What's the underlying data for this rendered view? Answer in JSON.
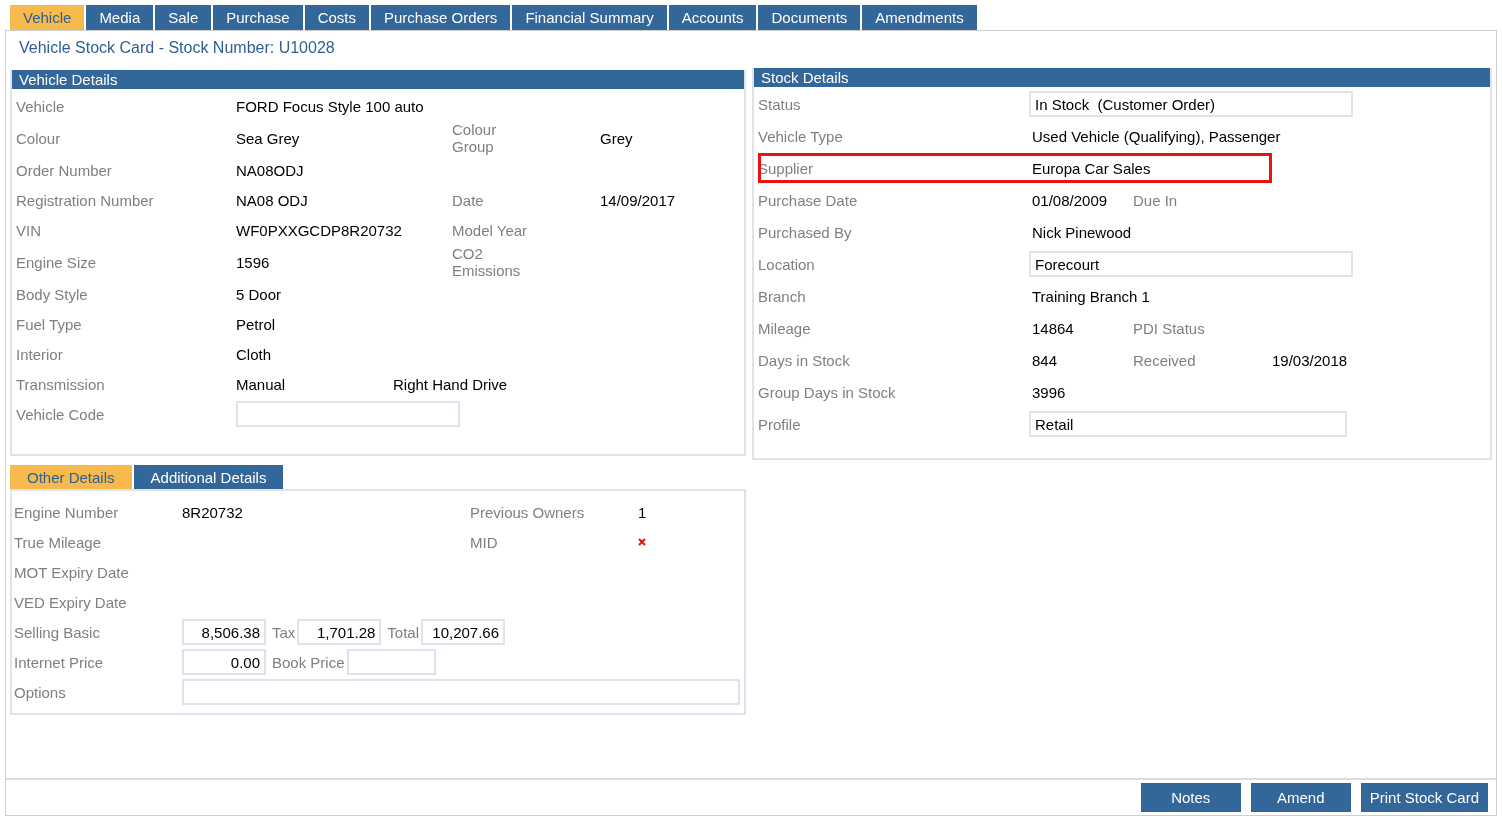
{
  "tabs": [
    {
      "label": "Vehicle",
      "selected": true
    },
    {
      "label": "Media",
      "selected": false
    },
    {
      "label": "Sale",
      "selected": false
    },
    {
      "label": "Purchase",
      "selected": false
    },
    {
      "label": "Costs",
      "selected": false
    },
    {
      "label": "Purchase Orders",
      "selected": false
    },
    {
      "label": "Financial Summary",
      "selected": false
    },
    {
      "label": "Accounts",
      "selected": false
    },
    {
      "label": "Documents",
      "selected": false
    },
    {
      "label": "Amendments",
      "selected": false
    }
  ],
  "page_title": "Vehicle Stock Card - Stock Number: U10028",
  "vehicle_details": {
    "title": "Vehicle Details",
    "rows": [
      {
        "label": "Vehicle",
        "value": "FORD Focus Style 100 auto"
      },
      {
        "label": "Colour",
        "value": "Sea Grey",
        "label2": "Colour Group",
        "value2": "Grey"
      },
      {
        "label": "Order Number",
        "value": "NA08ODJ"
      },
      {
        "label": "Registration Number",
        "value": "NA08 ODJ",
        "label2": "Date",
        "value2": "14/09/2017"
      },
      {
        "label": "VIN",
        "value": "WF0PXXGCDP8R20732",
        "label2": "Model Year"
      },
      {
        "label": "Engine Size",
        "value": "1596",
        "label2": "CO2 Emissions"
      },
      {
        "label": "Body Style",
        "value": "5 Door"
      },
      {
        "label": "Fuel Type",
        "value": "Petrol"
      },
      {
        "label": "Interior",
        "value": "Cloth"
      },
      {
        "label": "Transmission",
        "value": "Manual",
        "extra": "Right Hand Drive"
      },
      {
        "label": "Vehicle Code",
        "kind": "input"
      }
    ]
  },
  "stock_details": {
    "title": "Stock Details",
    "rows": [
      {
        "label": "Status",
        "value": "In Stock  (Customer Order)",
        "kind": "input",
        "highlighted": false
      },
      {
        "label": "Vehicle Type",
        "value": "Used Vehicle (Qualifying), Passenger",
        "highlighted": false
      },
      {
        "label": "Supplier",
        "value": "Europa Car Sales",
        "highlighted": true
      },
      {
        "label": "Purchase Date",
        "value": "01/08/2009",
        "label2": "Due In",
        "highlighted": false
      },
      {
        "label": "Purchased By",
        "value": "Nick Pinewood",
        "highlighted": false
      },
      {
        "label": "Location",
        "value": "Forecourt",
        "kind": "input",
        "highlighted": false
      },
      {
        "label": "Branch",
        "value": "Training Branch 1",
        "highlighted": false
      },
      {
        "label": "Mileage",
        "value": "14864",
        "label2": "PDI Status",
        "highlighted": false
      },
      {
        "label": "Days in Stock",
        "value": "844",
        "label2": "Received",
        "value2": "19/03/2018",
        "highlighted": false
      },
      {
        "label": "Group Days in Stock",
        "value": "3996",
        "highlighted": false
      },
      {
        "label": "Profile",
        "value": "Retail",
        "kind": "input",
        "highlighted": false
      }
    ]
  },
  "detail_tabs": [
    {
      "label": "Other Details",
      "selected": true
    },
    {
      "label": "Additional Details",
      "selected": false
    }
  ],
  "other_details": {
    "rows": [
      {
        "label": "Engine Number",
        "cells": [
          {
            "kind": "text",
            "text": "8R20732"
          }
        ],
        "right": {
          "label": "Previous Owners",
          "value": "1"
        }
      },
      {
        "label": "True Mileage",
        "right": {
          "label": "MID",
          "kind": "cross"
        }
      },
      {
        "label": "MOT Expiry Date"
      },
      {
        "label": "VED Expiry Date"
      },
      {
        "label": "Selling Basic",
        "cells": [
          {
            "kind": "input",
            "text": "8,506.38"
          },
          {
            "kind": "label",
            "text": "Tax"
          },
          {
            "kind": "input",
            "text": "1,701.28"
          },
          {
            "kind": "label",
            "text": "Total"
          },
          {
            "kind": "input",
            "text": "10,207.66"
          }
        ]
      },
      {
        "label": "Internet Price",
        "cells": [
          {
            "kind": "input",
            "text": "0.00"
          },
          {
            "kind": "label",
            "text": "Book Price"
          },
          {
            "kind": "input"
          }
        ]
      },
      {
        "label": "Options",
        "cells": [
          {
            "kind": "wide-input"
          }
        ]
      }
    ]
  },
  "buttons": [
    "Notes",
    "Amend",
    "Print Stock Card"
  ]
}
